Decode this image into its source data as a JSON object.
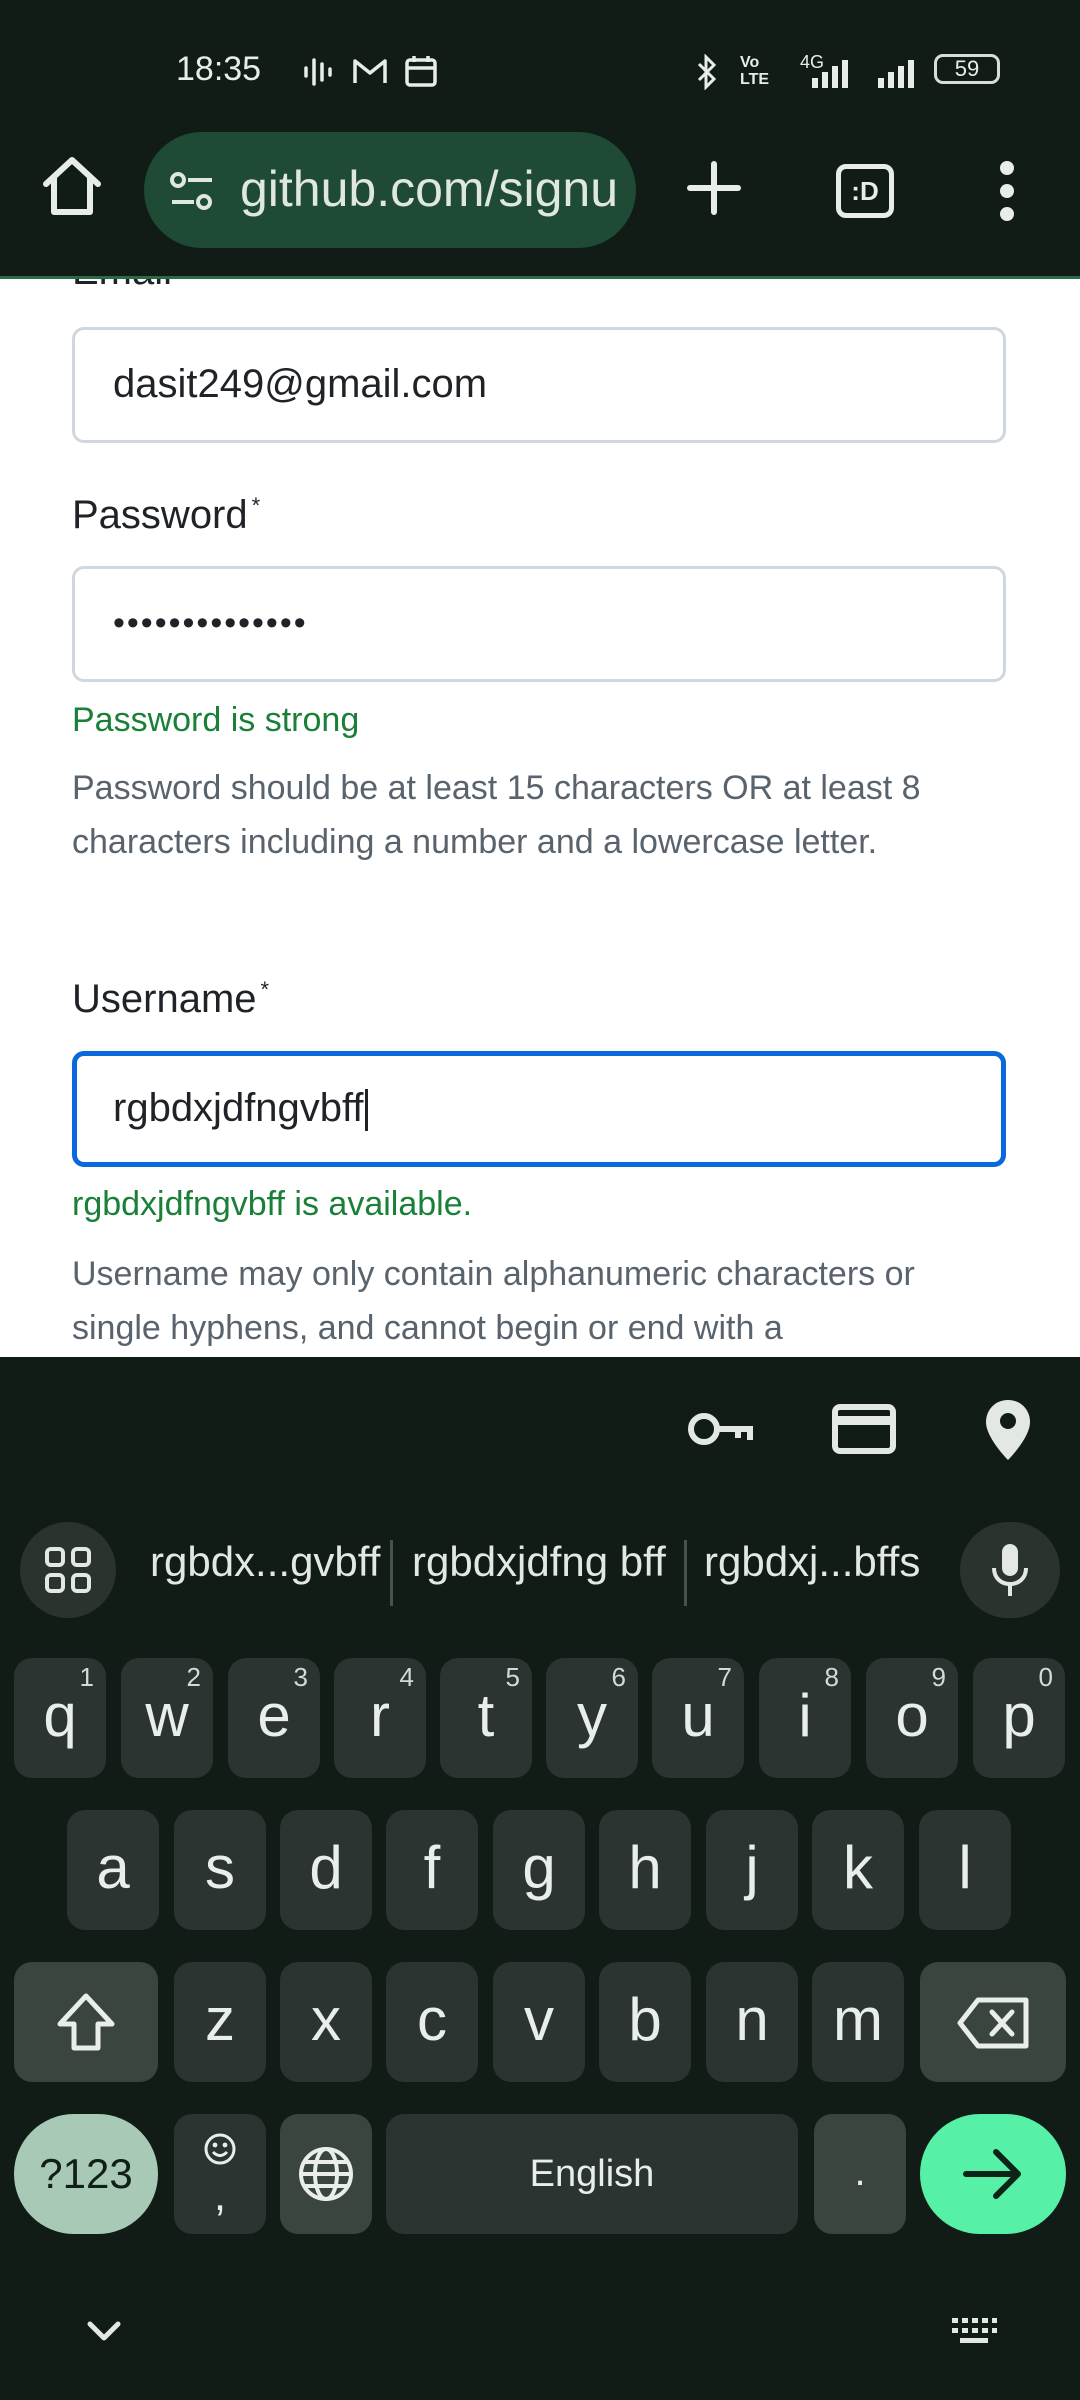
{
  "status_bar": {
    "time": "18:35",
    "network_label": "4G",
    "volte_label": "Vo LTE",
    "battery": "59"
  },
  "browser": {
    "url": "github.com/signup",
    "tabs_label": ":D"
  },
  "form": {
    "email_label": "Email",
    "email_value": "dasit249@gmail.com",
    "password_label": "Password",
    "password_value": "••••••••••••••",
    "password_strength": "Password is strong",
    "password_hint": "Password should be at least 15 characters OR at least 8 characters including a number and a lowercase letter.",
    "username_label": "Username",
    "username_value": "rgbdxjdfngvbff",
    "username_status": "rgbdxjdfngvbff is available.",
    "username_hint": "Username may only contain alphanumeric characters or single hyphens, and cannot begin or end with a",
    "required_mark": "*"
  },
  "suggestions": [
    "rgbdx...gvbff",
    "rgbdxjdfng bff",
    "rgbdxj...bffs"
  ],
  "keyboard": {
    "row1": [
      {
        "key": "q",
        "hint": "1"
      },
      {
        "key": "w",
        "hint": "2"
      },
      {
        "key": "e",
        "hint": "3"
      },
      {
        "key": "r",
        "hint": "4"
      },
      {
        "key": "t",
        "hint": "5"
      },
      {
        "key": "y",
        "hint": "6"
      },
      {
        "key": "u",
        "hint": "7"
      },
      {
        "key": "i",
        "hint": "8"
      },
      {
        "key": "o",
        "hint": "9"
      },
      {
        "key": "p",
        "hint": "0"
      }
    ],
    "row2": [
      "a",
      "s",
      "d",
      "f",
      "g",
      "h",
      "j",
      "k",
      "l"
    ],
    "row3": [
      "z",
      "x",
      "c",
      "v",
      "b",
      "n",
      "m"
    ],
    "symbols_label": "?123",
    "comma_label": ",",
    "space_label": "English",
    "period_label": "."
  },
  "colors": {
    "accent_focus": "#0969da",
    "success_text": "#1a7f37",
    "enter_key": "#56f0a6",
    "url_pill": "#1f4a36"
  }
}
